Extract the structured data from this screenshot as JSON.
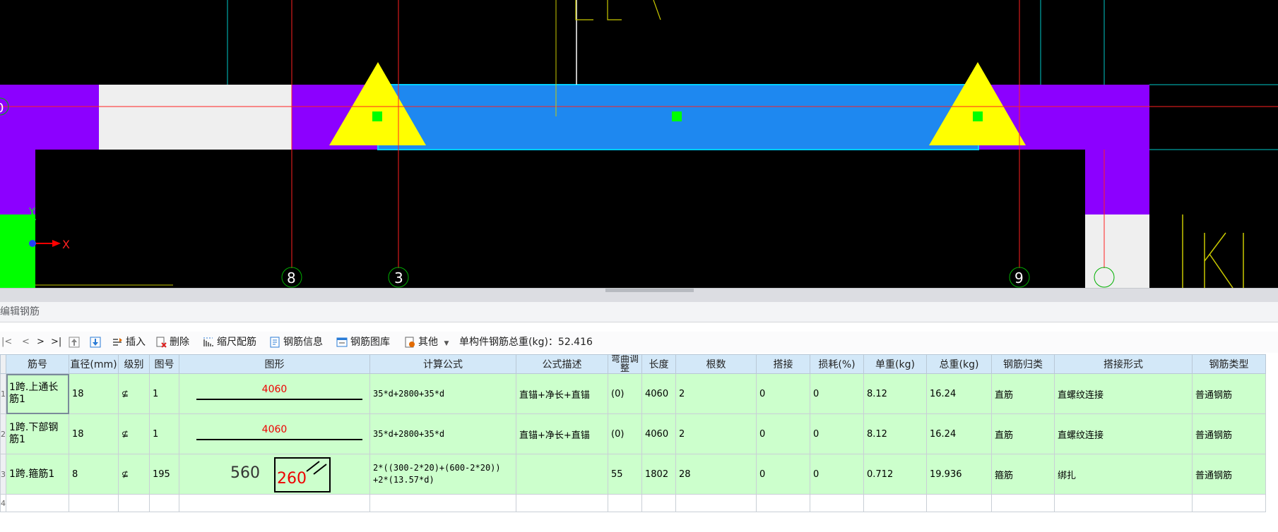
{
  "cad": {
    "axis_labels": [
      "8",
      "3",
      "9"
    ],
    "left_marker": "0",
    "y_axis": "Y",
    "x_axis": "X"
  },
  "panel": {
    "title": "编辑钢筋"
  },
  "toolbar": {
    "nav_first": "|<",
    "nav_prev": "<",
    "nav_next": ">",
    "nav_last": ">|",
    "insert": "插入",
    "delete": "删除",
    "scale_rebar": "缩尺配筋",
    "rebar_info": "钢筋信息",
    "rebar_library": "钢筋图库",
    "other": "其他",
    "total_weight_label": "单构件钢筋总重(kg)：",
    "total_weight_value": "52.416"
  },
  "table": {
    "headers": [
      "筋号",
      "直径(mm)",
      "级别",
      "图号",
      "图形",
      "计算公式",
      "公式描述",
      "弯曲调整",
      "长度",
      "根数",
      "搭接",
      "损耗(%)",
      "单重(kg)",
      "总重(kg)",
      "钢筋归类",
      "搭接形式",
      "钢筋类型"
    ],
    "rows": [
      {
        "row_num": "1",
        "name": "1跨.上通长筋1",
        "diameter": "18",
        "grade": "⊈",
        "shape_no": "1",
        "shape_value": "4060",
        "formula": "35*d+2800+35*d",
        "desc": "直锚+净长+直锚",
        "bend": "(0)",
        "length": "4060",
        "count": "2",
        "lap": "0",
        "loss": "0",
        "unit_weight": "8.12",
        "total_weight": "16.24",
        "category": "直筋",
        "lap_type": "直螺纹连接",
        "type": "普通钢筋"
      },
      {
        "row_num": "2",
        "name": "1跨.下部钢筋1",
        "diameter": "18",
        "grade": "⊈",
        "shape_no": "1",
        "shape_value": "4060",
        "formula": "35*d+2800+35*d",
        "desc": "直锚+净长+直锚",
        "bend": "(0)",
        "length": "4060",
        "count": "2",
        "lap": "0",
        "loss": "0",
        "unit_weight": "8.12",
        "total_weight": "16.24",
        "category": "直筋",
        "lap_type": "直螺纹连接",
        "type": "普通钢筋"
      },
      {
        "row_num": "3",
        "name": "1跨.箍筋1",
        "diameter": "8",
        "grade": "⊈",
        "shape_no": "195",
        "shape_value_a": "560",
        "shape_value_b": "260",
        "formula_1": "2*((300-2*20)+(600-2*20))",
        "formula_2": "+2*(13.57*d)",
        "desc": "",
        "bend": "55",
        "length": "1802",
        "count": "28",
        "lap": "0",
        "loss": "0",
        "unit_weight": "0.712",
        "total_weight": "19.936",
        "category": "箍筋",
        "lap_type": "绑扎",
        "type": "普通钢筋"
      }
    ],
    "empty_row_num": "4"
  }
}
